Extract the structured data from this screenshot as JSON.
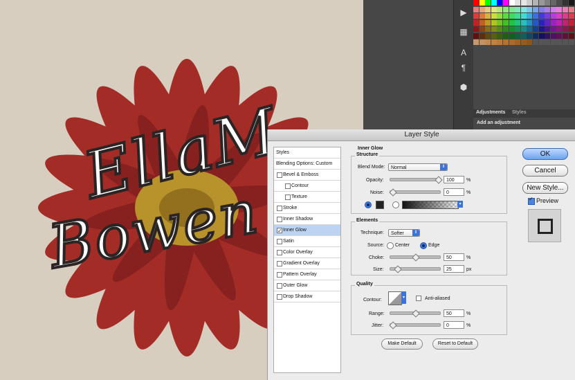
{
  "canvas": {
    "art_line1": "EllaM",
    "art_line2": "Bowen",
    "bg": "#d7cec0",
    "petal": "#a8302a",
    "center": "#b8922a"
  },
  "right_panel": {
    "tabs": [
      "Adjustments",
      "Styles"
    ],
    "subtitle": "Add an adjustment",
    "tool_icons": [
      "play-icon",
      "brush-preset-icon",
      "type-icon",
      "paragraph-icon",
      "3d-cube-icon"
    ]
  },
  "dialog": {
    "title": "Layer Style",
    "styles_list": [
      {
        "label": "Styles",
        "checkbox": false,
        "checked": false,
        "selected": false,
        "indent": 0
      },
      {
        "label": "Blending Options: Custom",
        "checkbox": false,
        "checked": false,
        "selected": false,
        "indent": 0
      },
      {
        "label": "Bevel & Emboss",
        "checkbox": true,
        "checked": false,
        "selected": false,
        "indent": 0
      },
      {
        "label": "Contour",
        "checkbox": true,
        "checked": false,
        "selected": false,
        "indent": 1
      },
      {
        "label": "Texture",
        "checkbox": true,
        "checked": false,
        "selected": false,
        "indent": 1
      },
      {
        "label": "Stroke",
        "checkbox": true,
        "checked": false,
        "selected": false,
        "indent": 0
      },
      {
        "label": "Inner Shadow",
        "checkbox": true,
        "checked": false,
        "selected": false,
        "indent": 0
      },
      {
        "label": "Inner Glow",
        "checkbox": true,
        "checked": true,
        "selected": true,
        "indent": 0
      },
      {
        "label": "Satin",
        "checkbox": true,
        "checked": false,
        "selected": false,
        "indent": 0
      },
      {
        "label": "Color Overlay",
        "checkbox": true,
        "checked": false,
        "selected": false,
        "indent": 0
      },
      {
        "label": "Gradient Overlay",
        "checkbox": true,
        "checked": false,
        "selected": false,
        "indent": 0
      },
      {
        "label": "Pattern Overlay",
        "checkbox": true,
        "checked": false,
        "selected": false,
        "indent": 0
      },
      {
        "label": "Outer Glow",
        "checkbox": true,
        "checked": false,
        "selected": false,
        "indent": 0
      },
      {
        "label": "Drop Shadow",
        "checkbox": true,
        "checked": false,
        "selected": false,
        "indent": 0
      }
    ],
    "inner_glow": {
      "header": "Inner Glow",
      "structure": {
        "title": "Structure",
        "blend_mode_label": "Blend Mode:",
        "blend_mode": "Normal",
        "opacity_label": "Opacity:",
        "opacity": "100",
        "opacity_value": 100,
        "noise_label": "Noise:",
        "noise": "0",
        "noise_value": 0,
        "pct": "%",
        "glow_color": "#222222"
      },
      "elements": {
        "title": "Elements",
        "technique_label": "Technique:",
        "technique": "Softer",
        "source_label": "Source:",
        "source_center": "Center",
        "source_edge": "Edge",
        "choke_label": "Choke:",
        "choke": "50",
        "choke_value": 50,
        "size_label": "Size:",
        "size": "25",
        "size_value": 25,
        "px": "px",
        "pct": "%"
      },
      "quality": {
        "title": "Quality",
        "contour_label": "Contour:",
        "anti_aliased": "Anti-aliased",
        "range_label": "Range:",
        "range": "50",
        "range_value": 50,
        "jitter_label": "Jitter:",
        "jitter": "0",
        "jitter_value": 0,
        "pct": "%"
      },
      "make_default": "Make Default",
      "reset_default": "Reset to Default"
    },
    "buttons": {
      "ok": "OK",
      "cancel": "Cancel",
      "new_style": "New Style...",
      "preview": "Preview"
    }
  }
}
